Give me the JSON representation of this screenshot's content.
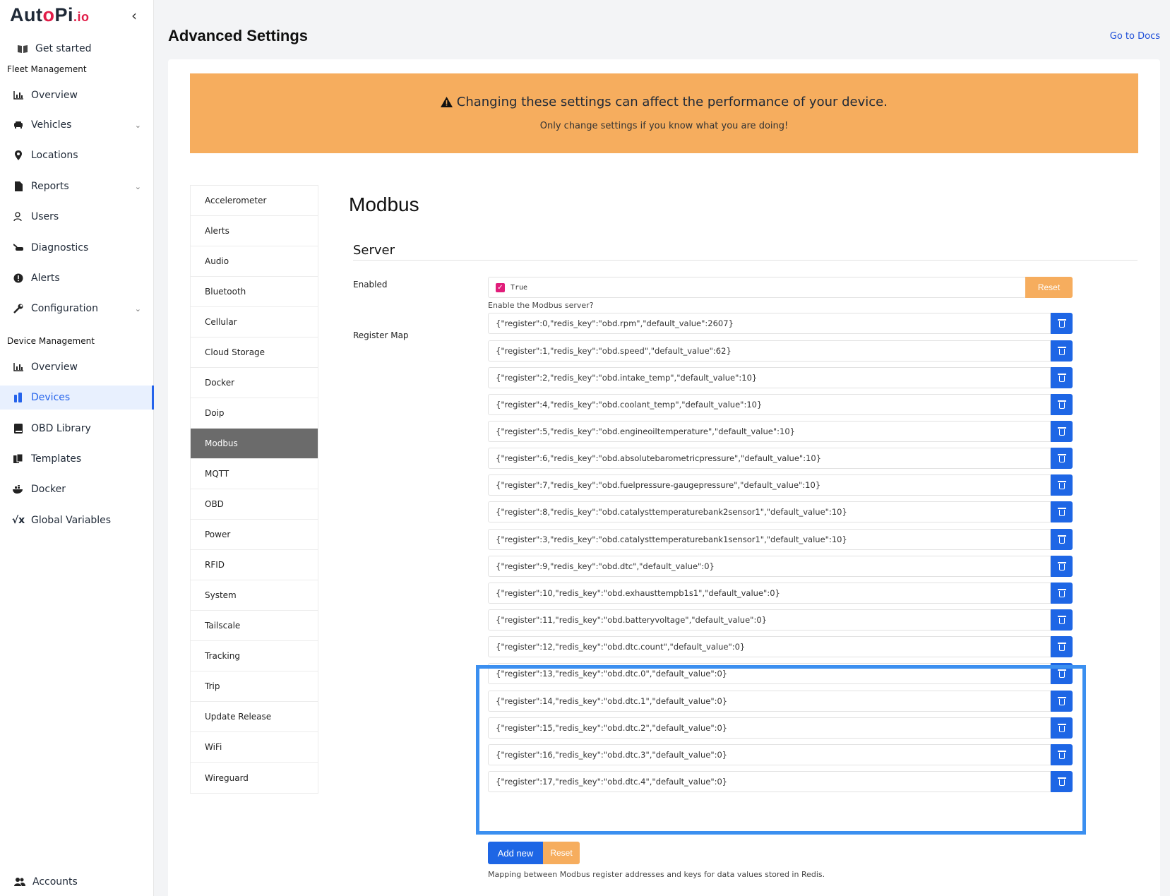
{
  "sidebar": {
    "logo_main": "Aut",
    "logo_dot": "o",
    "logo_rest": "Pi",
    "logo_suffix": ".io",
    "get_started": "Get started",
    "fleet_label": "Fleet Management",
    "fleet_items": [
      {
        "label": "Overview",
        "icon": "chart-icon"
      },
      {
        "label": "Vehicles",
        "icon": "car-icon"
      },
      {
        "label": "Locations",
        "icon": "pin-icon"
      },
      {
        "label": "Reports",
        "icon": "file-icon"
      },
      {
        "label": "Users",
        "icon": "users-icon"
      },
      {
        "label": "Diagnostics",
        "icon": "wrench-car-icon"
      },
      {
        "label": "Alerts",
        "icon": "alert-icon"
      },
      {
        "label": "Configuration",
        "icon": "wrench-icon"
      }
    ],
    "device_label": "Device Management",
    "device_items": [
      {
        "label": "Overview",
        "icon": "chart-icon"
      },
      {
        "label": "Devices",
        "icon": "devices-icon"
      },
      {
        "label": "OBD Library",
        "icon": "book-icon"
      },
      {
        "label": "Templates",
        "icon": "templates-icon"
      },
      {
        "label": "Docker",
        "icon": "docker-icon"
      },
      {
        "label": "Global Variables",
        "icon": "sqrt-icon"
      }
    ],
    "accounts": "Accounts"
  },
  "header": {
    "title": "Advanced Settings",
    "docs_link": "Go to Docs"
  },
  "warning": {
    "line1": "Changing these settings can affect the performance of your device.",
    "line2": "Only change settings if you know what you are doing!"
  },
  "settings_menu": [
    "Accelerometer",
    "Alerts",
    "Audio",
    "Bluetooth",
    "Cellular",
    "Cloud Storage",
    "Docker",
    "Doip",
    "Modbus",
    "MQTT",
    "OBD",
    "Power",
    "RFID",
    "System",
    "Tailscale",
    "Tracking",
    "Trip",
    "Update Release",
    "WiFi",
    "Wireguard"
  ],
  "settings_menu_active": "Modbus",
  "content": {
    "title": "Modbus",
    "section": "Server",
    "enabled_label": "Enabled",
    "enabled_value": "True",
    "enabled_reset": "Reset",
    "enabled_help": "Enable the Modbus server?",
    "register_label": "Register Map",
    "registers": [
      "{\"register\":0,\"redis_key\":\"obd.rpm\",\"default_value\":2607}",
      "{\"register\":1,\"redis_key\":\"obd.speed\",\"default_value\":62}",
      "{\"register\":2,\"redis_key\":\"obd.intake_temp\",\"default_value\":10}",
      "{\"register\":4,\"redis_key\":\"obd.coolant_temp\",\"default_value\":10}",
      "{\"register\":5,\"redis_key\":\"obd.engineoiltemperature\",\"default_value\":10}",
      "{\"register\":6,\"redis_key\":\"obd.absolutebarometricpressure\",\"default_value\":10}",
      "{\"register\":7,\"redis_key\":\"obd.fuelpressure-gaugepressure\",\"default_value\":10}",
      "{\"register\":8,\"redis_key\":\"obd.catalysttemperaturebank2sensor1\",\"default_value\":10}",
      "{\"register\":3,\"redis_key\":\"obd.catalysttemperaturebank1sensor1\",\"default_value\":10}",
      "{\"register\":9,\"redis_key\":\"obd.dtc\",\"default_value\":0}",
      "{\"register\":10,\"redis_key\":\"obd.exhausttempb1s1\",\"default_value\":0}",
      "{\"register\":11,\"redis_key\":\"obd.batteryvoltage\",\"default_value\":0}",
      "{\"register\":12,\"redis_key\":\"obd.dtc.count\",\"default_value\":0}",
      "{\"register\":13,\"redis_key\":\"obd.dtc.0\",\"default_value\":0}",
      "{\"register\":14,\"redis_key\":\"obd.dtc.1\",\"default_value\":0}",
      "{\"register\":15,\"redis_key\":\"obd.dtc.2\",\"default_value\":0}",
      "{\"register\":16,\"redis_key\":\"obd.dtc.3\",\"default_value\":0}",
      "{\"register\":17,\"redis_key\":\"obd.dtc.4\",\"default_value\":0}"
    ],
    "add_new": "Add new",
    "reset": "Reset",
    "register_help": "Mapping between Modbus register addresses and keys for data values stored in Redis."
  }
}
